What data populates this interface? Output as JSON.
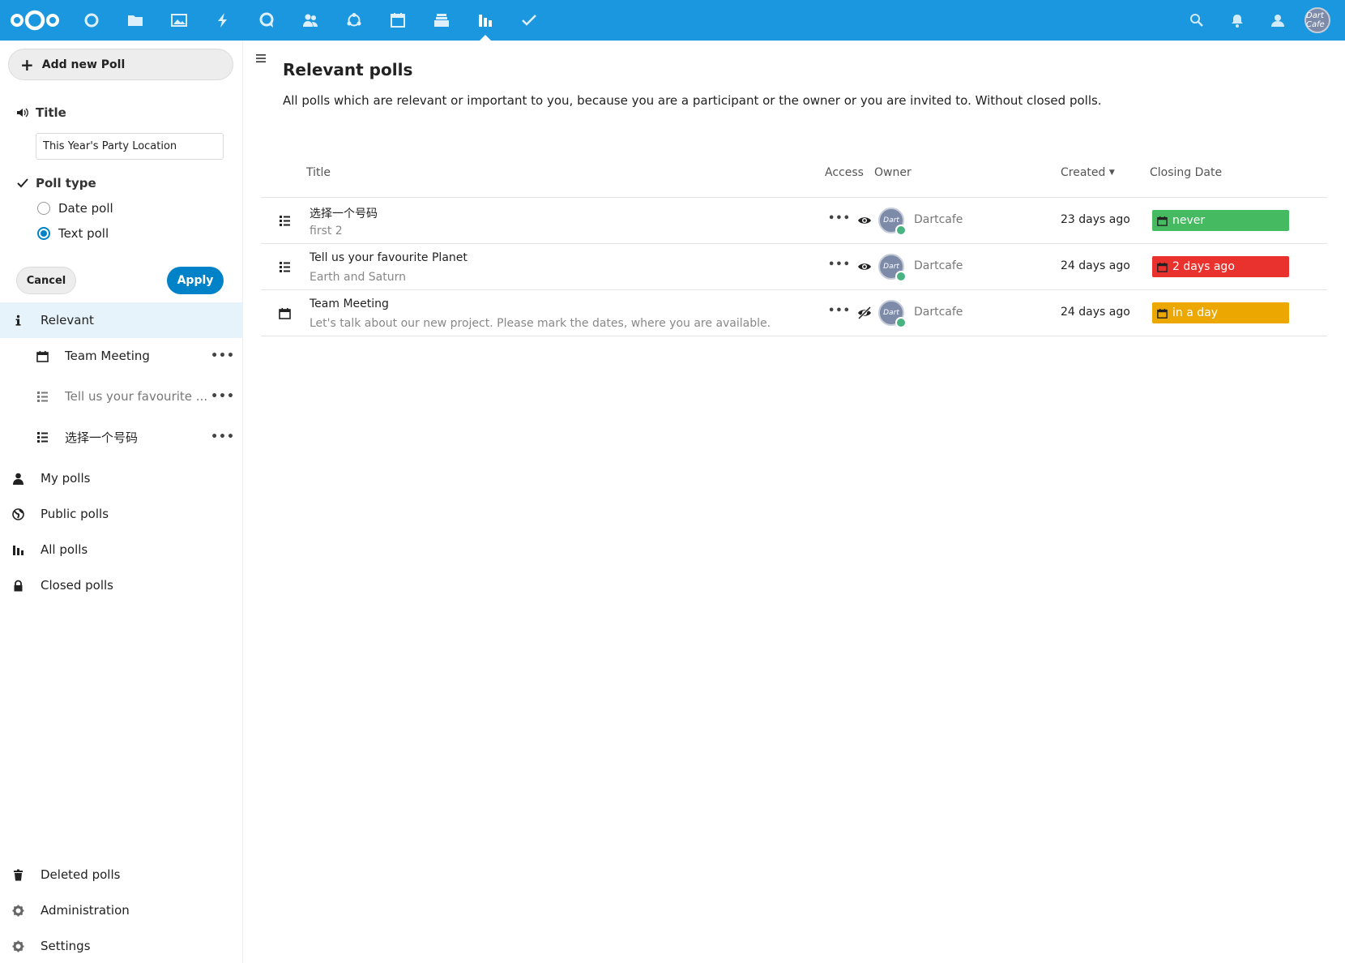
{
  "header": {
    "apps": [
      {
        "name": "dashboard-icon"
      },
      {
        "name": "files-icon"
      },
      {
        "name": "photos-icon"
      },
      {
        "name": "activity-icon"
      },
      {
        "name": "talk-icon"
      },
      {
        "name": "contacts-icon"
      },
      {
        "name": "circles-icon"
      },
      {
        "name": "calendar-icon"
      },
      {
        "name": "deck-icon"
      },
      {
        "name": "polls-icon"
      },
      {
        "name": "tasks-icon"
      }
    ],
    "active_app": "polls-icon",
    "avatar_text": "Dart Cafe",
    "accent_color": "#1b97e0"
  },
  "sidebar": {
    "add_label": "Add new Poll",
    "title_section": "Title",
    "title_value": "This Year's Party Location",
    "poll_type_section": "Poll type",
    "date_poll_label": "Date poll",
    "text_poll_label": "Text poll",
    "selected_type": "Text poll",
    "cancel_label": "Cancel",
    "apply_label": "Apply",
    "relevant_label": "Relevant",
    "relevant_items": [
      {
        "label": "Team Meeting",
        "icon": "calendar-icon"
      },
      {
        "label": "Tell us your favourite ...",
        "icon": "list-icon"
      },
      {
        "label": "选择一个号码",
        "icon": "list-icon"
      }
    ],
    "my_polls_label": "My polls",
    "public_polls_label": "Public polls",
    "all_polls_label": "All polls",
    "closed_polls_label": "Closed polls",
    "deleted_polls_label": "Deleted polls",
    "administration_label": "Administration",
    "settings_label": "Settings",
    "more_label": "•••"
  },
  "main": {
    "title": "Relevant polls",
    "description": "All polls which are relevant or important to you, because you are a participant or the owner or you are invited to. Without closed polls.",
    "columns": {
      "title": "Title",
      "access": "Access",
      "owner": "Owner",
      "created": "Created",
      "closing": "Closing Date"
    },
    "rows": [
      {
        "title": "选择一个号码",
        "description": "first 2",
        "type": "list-icon",
        "access": "eye-icon",
        "owner": "Dartcafe",
        "avatar_text": "Dart",
        "created": "23 days ago",
        "closing": "never",
        "closing_color": "#46ba61",
        "more": "•••"
      },
      {
        "title": "Tell us your favourite Planet",
        "description": "Earth and Saturn",
        "type": "list-icon",
        "access": "eye-icon",
        "owner": "Dartcafe",
        "avatar_text": "Dart",
        "created": "24 days ago",
        "closing": "2 days ago",
        "closing_color": "#e9322d",
        "more": "•••"
      },
      {
        "title": "Team Meeting",
        "description": "Let's talk about our new project. Please mark the dates, where you are available.",
        "type": "calendar-icon",
        "access": "eye-off-icon",
        "owner": "Dartcafe",
        "avatar_text": "Dart",
        "created": "24 days ago",
        "closing": "in a day",
        "closing_color": "#eca700",
        "more": "•••"
      }
    ]
  }
}
